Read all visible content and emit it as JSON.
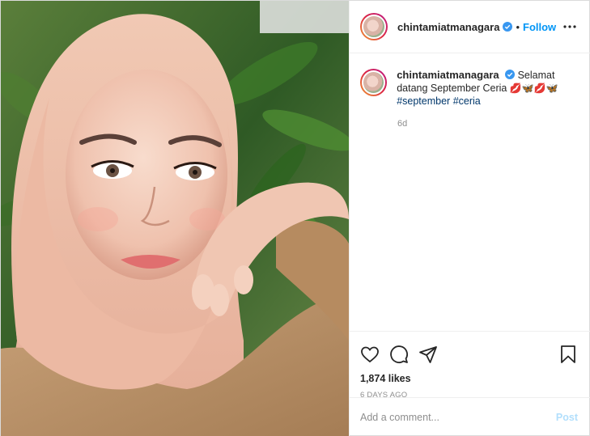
{
  "post": {
    "username": "chintamiatmanagara",
    "verified": true,
    "dot": "•",
    "follow_label": "Follow",
    "more_icon": "more-options-icon",
    "caption": {
      "text": "Selamat datang September Ceria",
      "emojis": "💋🦋💋🦋",
      "hashtags": [
        "#september",
        "#ceria"
      ]
    },
    "time": "6d",
    "likes": "1,874 likes",
    "date_ago": "6 DAYS AGO",
    "comment_placeholder": "Add a comment...",
    "post_label": "Post"
  },
  "icons": {
    "like": "heart-icon",
    "comment": "comment-icon",
    "share": "share-icon",
    "save": "bookmark-icon"
  },
  "colors": {
    "link": "#0095f6",
    "hashtag": "#00376b",
    "post_button_disabled": "#b2dffc",
    "verified_badge": "#3897f0"
  }
}
